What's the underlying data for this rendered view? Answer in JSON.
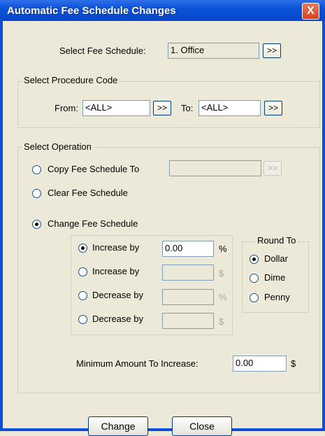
{
  "window": {
    "title": "Automatic Fee Schedule Changes",
    "close_glyph": "X"
  },
  "fee_schedule": {
    "label": "Select Fee Schedule:",
    "value": "1.  Office",
    "button": ">>"
  },
  "procedure": {
    "group_label": "Select Procedure Code",
    "from_label": "From:",
    "from_value": "<ALL>",
    "from_button": ">>",
    "to_label": "To:",
    "to_value": "<ALL>",
    "to_button": ">>"
  },
  "operation": {
    "group_label": "Select Operation",
    "copy_label": "Copy Fee Schedule To",
    "copy_value": "",
    "copy_button": ">>",
    "clear_label": "Clear Fee Schedule",
    "change_label": "Change Fee Schedule",
    "selected": "change",
    "adjustments": [
      {
        "label": "Increase by",
        "value": "0.00",
        "unit": "%",
        "selected": true
      },
      {
        "label": "Increase by",
        "value": "",
        "unit": "$",
        "selected": false
      },
      {
        "label": "Decrease by",
        "value": "",
        "unit": "%",
        "selected": false
      },
      {
        "label": "Decrease by",
        "value": "",
        "unit": "$",
        "selected": false
      }
    ],
    "round_to": {
      "group_label": "Round To",
      "options": [
        "Dollar",
        "Dime",
        "Penny"
      ],
      "selected": "Dollar"
    },
    "minimum": {
      "label": "Minimum Amount To Increase:",
      "value": "0.00",
      "unit": "$"
    }
  },
  "buttons": {
    "change": "Change",
    "close": "Close"
  }
}
